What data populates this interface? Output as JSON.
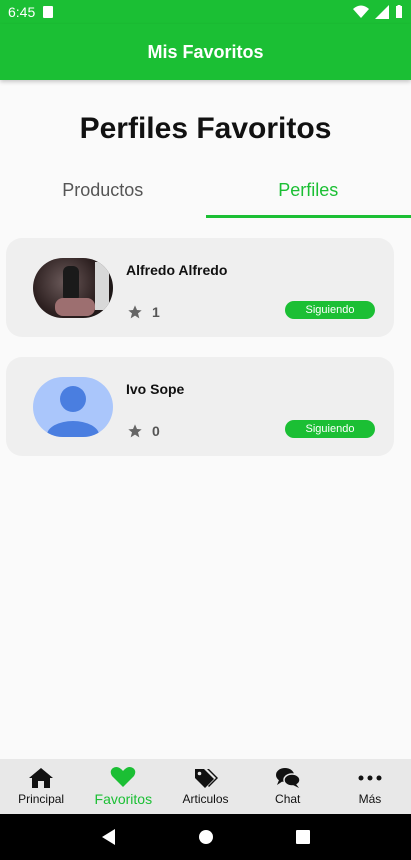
{
  "status_bar": {
    "time": "6:45"
  },
  "app_bar": {
    "title": "Mis Favoritos"
  },
  "page": {
    "title": "Perfiles Favoritos"
  },
  "tabs": [
    {
      "label": "Productos",
      "active": false
    },
    {
      "label": "Perfiles",
      "active": true
    }
  ],
  "profiles": [
    {
      "name": "Alfredo Alfredo",
      "rating": "1",
      "follow_label": "Siguiendo",
      "avatar": "photo"
    },
    {
      "name": "Ivo Sope",
      "rating": "0",
      "follow_label": "Siguiendo",
      "avatar": "default-person-icon"
    }
  ],
  "bottom_nav": [
    {
      "label": "Principal",
      "icon": "home-icon",
      "active": false
    },
    {
      "label": "Favoritos",
      "icon": "heart-icon",
      "active": true
    },
    {
      "label": "Articulos",
      "icon": "tags-icon",
      "active": false
    },
    {
      "label": "Chat",
      "icon": "chat-icon",
      "active": false
    },
    {
      "label": "Más",
      "icon": "more-icon",
      "active": false
    }
  ],
  "colors": {
    "accent": "#1bbf34",
    "card_bg": "#efefef",
    "nav_bg": "#e8e8e8"
  }
}
